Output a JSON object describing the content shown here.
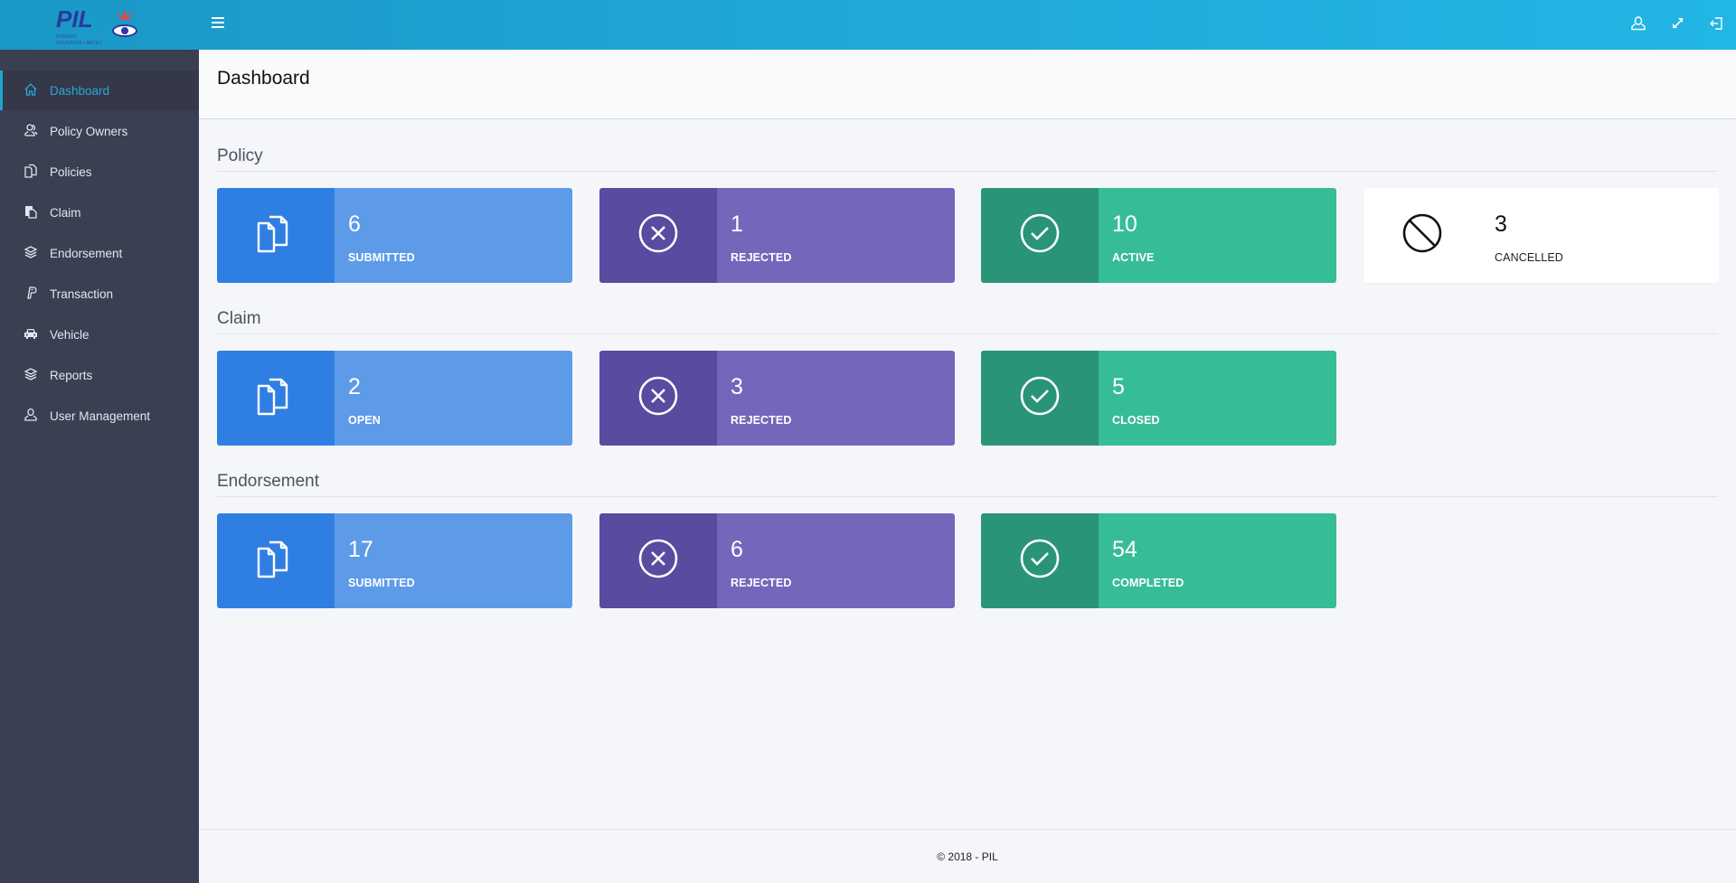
{
  "header": {
    "logo_text": "PIL",
    "logo_subtext": "PREMIER INSURANCE LIMITED",
    "menu_icon": "hamburger-icon",
    "actions": [
      {
        "name": "profile",
        "icon": "user-icon"
      },
      {
        "name": "fullscreen",
        "icon": "expand-icon"
      },
      {
        "name": "logout",
        "icon": "logout-icon"
      }
    ]
  },
  "sidebar": {
    "items": [
      {
        "label": "Dashboard",
        "icon": "home-icon",
        "active": true
      },
      {
        "label": "Policy Owners",
        "icon": "users-icon",
        "active": false
      },
      {
        "label": "Policies",
        "icon": "documents-icon",
        "active": false
      },
      {
        "label": "Claim",
        "icon": "file-copy-icon",
        "active": false
      },
      {
        "label": "Endorsement",
        "icon": "layers-icon",
        "active": false
      },
      {
        "label": "Transaction",
        "icon": "paypal-icon",
        "active": false
      },
      {
        "label": "Vehicle",
        "icon": "car-icon",
        "active": false
      },
      {
        "label": "Reports",
        "icon": "layers-icon",
        "active": false
      },
      {
        "label": "User Management",
        "icon": "user-icon",
        "active": false
      }
    ]
  },
  "page": {
    "title": "Dashboard"
  },
  "sections": [
    {
      "title": "Policy",
      "cards": [
        {
          "value": "6",
          "label": "SUBMITTED",
          "icon": "documents-icon",
          "color": "blue"
        },
        {
          "value": "1",
          "label": "REJECTED",
          "icon": "close-circle-icon",
          "color": "purple"
        },
        {
          "value": "10",
          "label": "ACTIVE",
          "icon": "check-circle-icon",
          "color": "green"
        },
        {
          "value": "3",
          "label": "CANCELLED",
          "icon": "ban-icon",
          "color": "white"
        }
      ]
    },
    {
      "title": "Claim",
      "cards": [
        {
          "value": "2",
          "label": "OPEN",
          "icon": "documents-icon",
          "color": "blue"
        },
        {
          "value": "3",
          "label": "REJECTED",
          "icon": "close-circle-icon",
          "color": "purple"
        },
        {
          "value": "5",
          "label": "CLOSED",
          "icon": "check-circle-icon",
          "color": "green"
        }
      ]
    },
    {
      "title": "Endorsement",
      "cards": [
        {
          "value": "17",
          "label": "SUBMITTED",
          "icon": "documents-icon",
          "color": "blue"
        },
        {
          "value": "6",
          "label": "REJECTED",
          "icon": "close-circle-icon",
          "color": "purple"
        },
        {
          "value": "54",
          "label": "COMPLETED",
          "icon": "check-circle-icon",
          "color": "green"
        }
      ]
    }
  ],
  "colors": {
    "header_start": "#1a98c6",
    "header_end": "#22b6e4",
    "sidebar_bg": "#3a3f51",
    "accent": "#1ea3d4",
    "blue_dark": "#2f7fe3",
    "blue_light": "#5d9be9",
    "purple_dark": "#584ba0",
    "purple_light": "#7367bb",
    "green_dark": "#2a9478",
    "green_light": "#37bc98"
  },
  "footer": {
    "text": "© 2018 - PIL"
  }
}
